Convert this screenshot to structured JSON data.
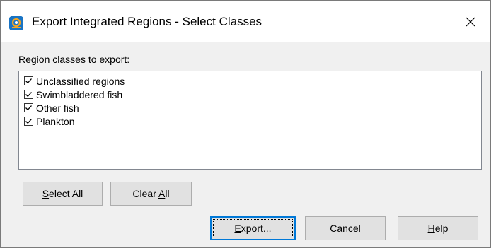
{
  "window": {
    "title": "Export Integrated Regions - Select Classes",
    "app_icon": "echoview-app-icon",
    "close_icon": "close-icon"
  },
  "section_label": "Region classes to export:",
  "classes": [
    {
      "label": "Unclassified regions",
      "checked": true
    },
    {
      "label": "Swimbladdered fish",
      "checked": true
    },
    {
      "label": "Other fish",
      "checked": true
    },
    {
      "label": "Plankton",
      "checked": true
    }
  ],
  "buttons": {
    "select_all": {
      "pre": "",
      "key": "S",
      "post": "elect All"
    },
    "clear_all": {
      "pre": "Clear ",
      "key": "A",
      "post": "ll"
    },
    "export": {
      "pre": "",
      "key": "E",
      "post": "xport..."
    },
    "cancel": {
      "label": "Cancel"
    },
    "help": {
      "pre": "",
      "key": "H",
      "post": "elp"
    }
  },
  "colors": {
    "accent": "#0078d7",
    "dialog_bg": "#f0f0f0",
    "button_bg": "#e1e1e1"
  }
}
